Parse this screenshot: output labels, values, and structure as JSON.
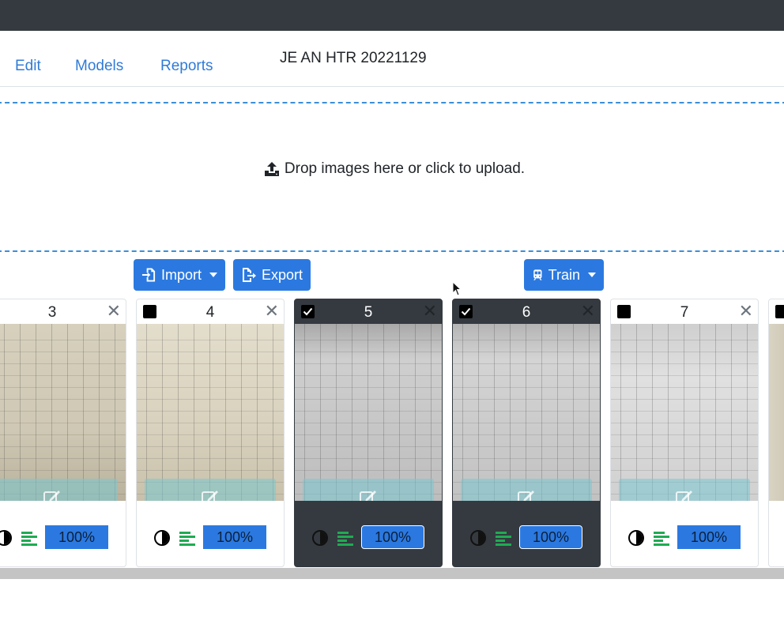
{
  "nav": {
    "links": [
      "Edit",
      "Models",
      "Reports"
    ],
    "doc_title": "JE AN HTR 20221129"
  },
  "dropzone": {
    "label": "Drop images here or click to upload."
  },
  "toolbar": {
    "import_label": "Import",
    "export_label": "Export",
    "train_label": "Train"
  },
  "cards": [
    {
      "number": "3",
      "selected": false,
      "percent": "100%"
    },
    {
      "number": "4",
      "selected": false,
      "percent": "100%"
    },
    {
      "number": "5",
      "selected": true,
      "percent": "100%"
    },
    {
      "number": "6",
      "selected": true,
      "percent": "100%"
    },
    {
      "number": "7",
      "selected": false,
      "percent": "100%"
    }
  ],
  "colors": {
    "topbar": "#343a40",
    "link": "#2f7bd8",
    "primary": "#2b79e0",
    "selected_card": "#343a40",
    "lines_icon": "#1fab52"
  },
  "icons": {
    "upload": "upload-icon",
    "import": "file-import-icon",
    "export": "file-export-icon",
    "train": "train-icon",
    "close": "close-icon",
    "contrast": "contrast-icon",
    "lines": "align-left-icon",
    "edit": "edit-icon"
  }
}
